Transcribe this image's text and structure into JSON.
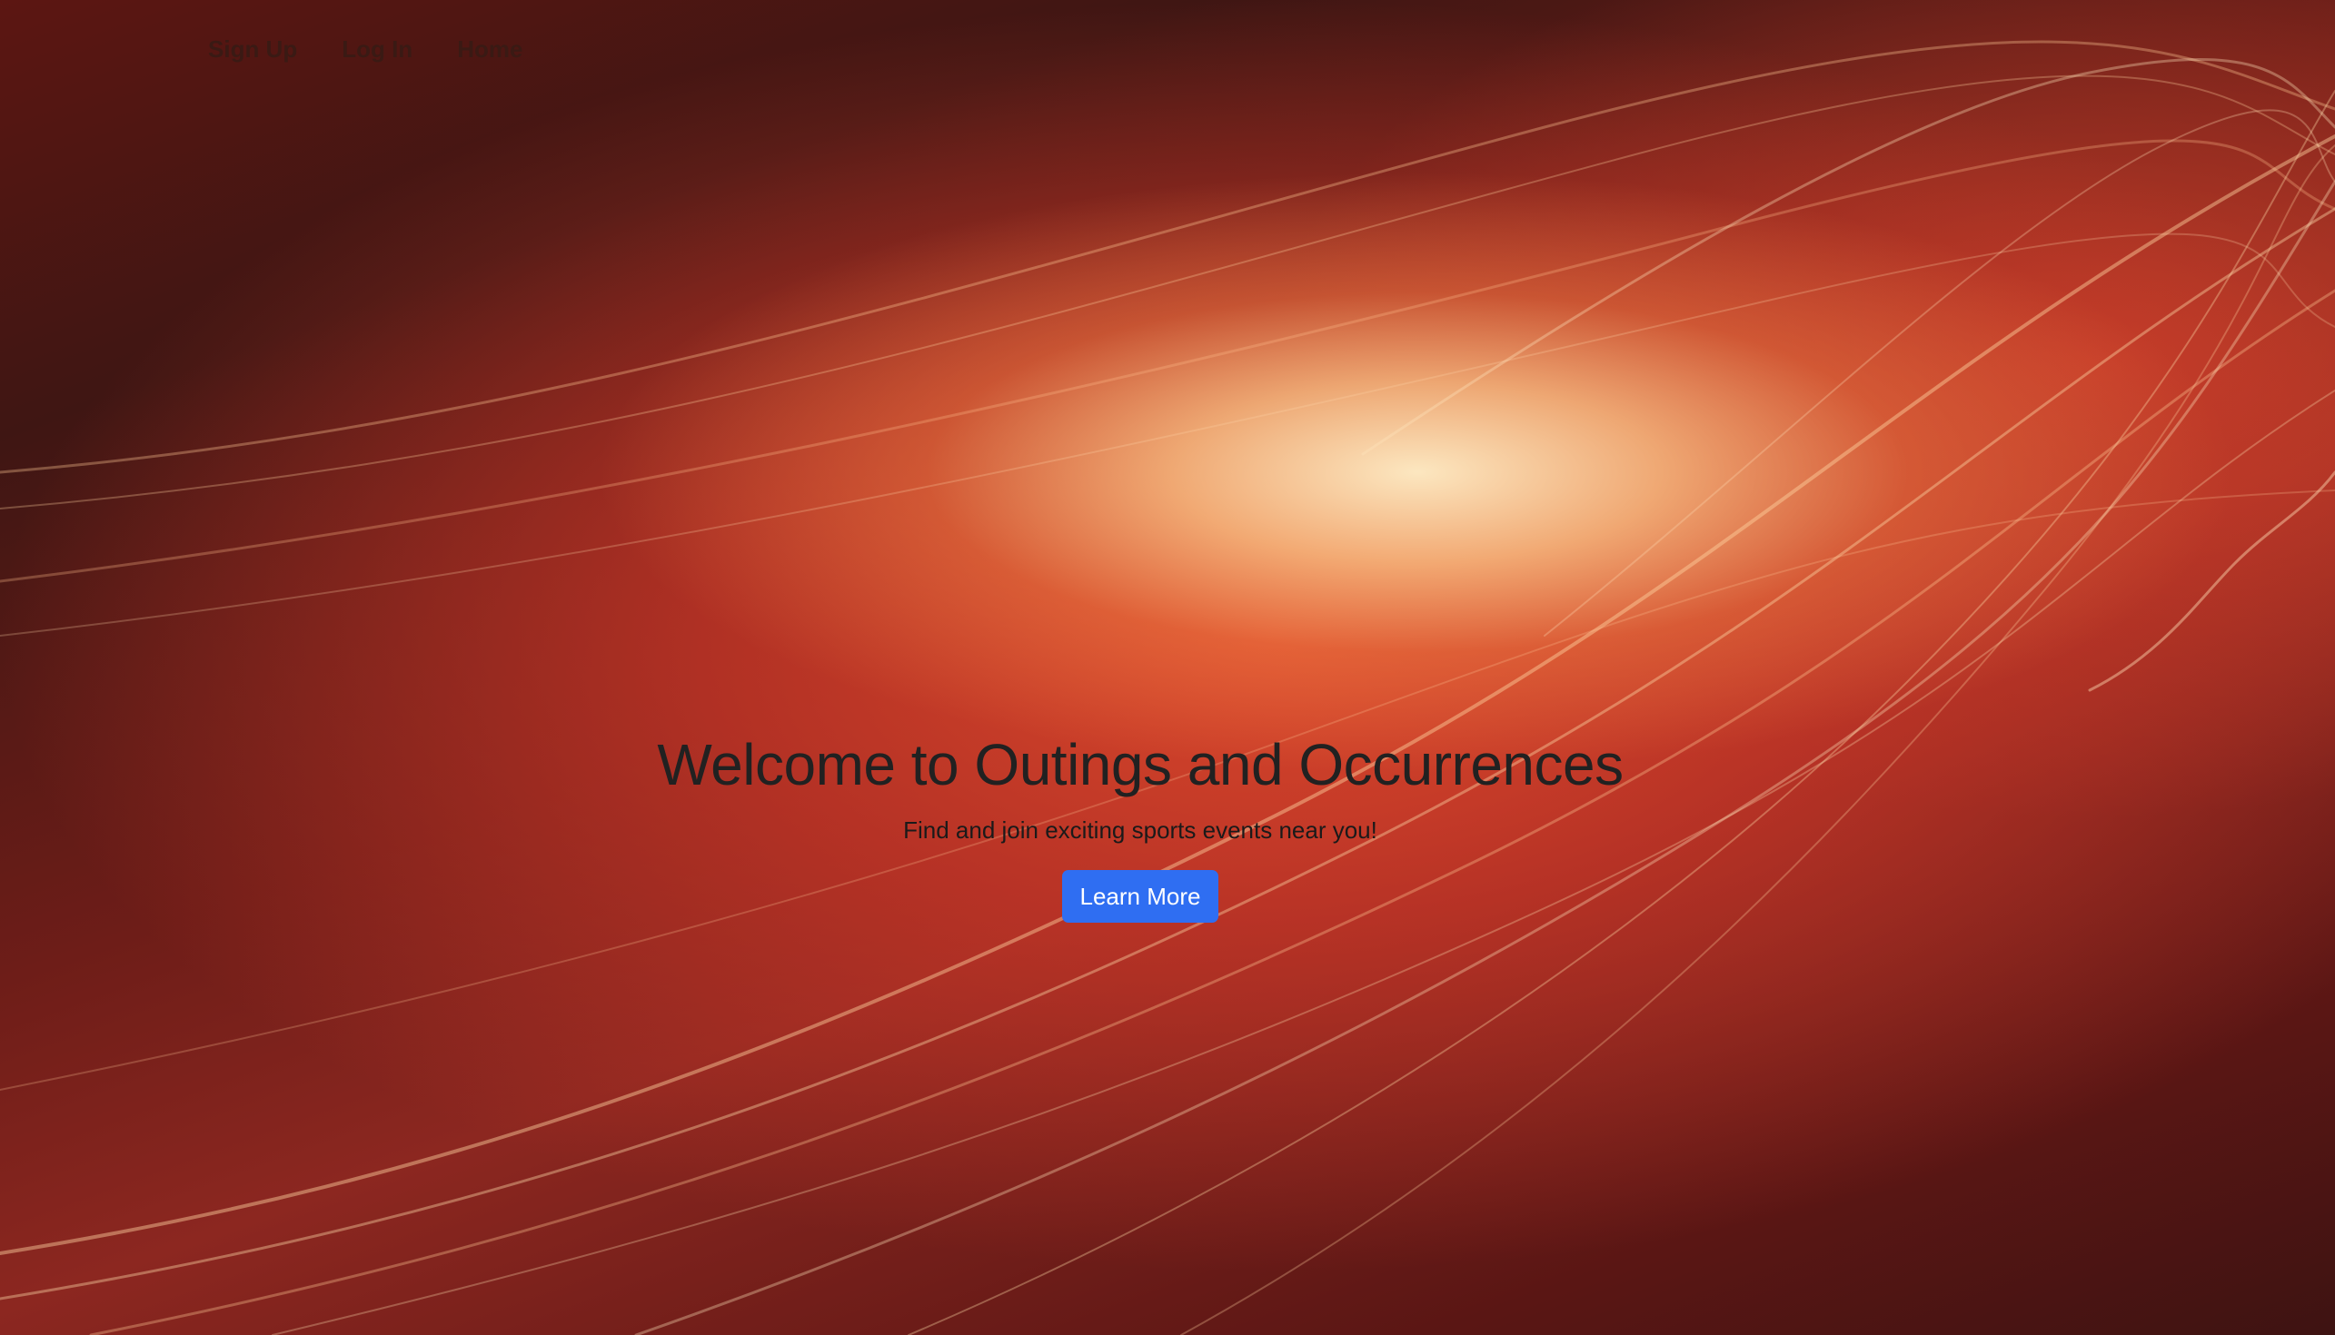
{
  "nav": {
    "items": [
      {
        "label": "Sign Up"
      },
      {
        "label": "Log In"
      },
      {
        "label": "Home"
      }
    ]
  },
  "hero": {
    "title": "Welcome to Outings and Occurrences",
    "subtitle": "Find and join exciting sports events near you!",
    "cta_label": "Learn More"
  },
  "colors": {
    "background": "#b8332a",
    "highlight": "#fde7c0",
    "button": "#2f6ef2",
    "button_text": "#ffffff",
    "heading_text": "#212121"
  }
}
